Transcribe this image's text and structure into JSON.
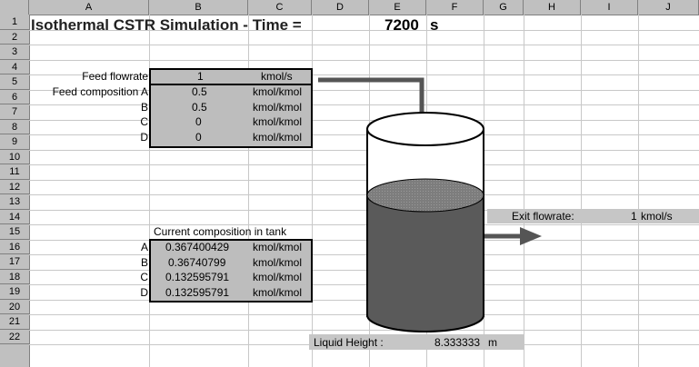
{
  "columns": [
    "A",
    "B",
    "C",
    "D",
    "E",
    "F",
    "G",
    "H",
    "I",
    "J"
  ],
  "rows": [
    "1",
    "2",
    "3",
    "4",
    "5",
    "6",
    "7",
    "8",
    "9",
    "10",
    "11",
    "12",
    "13",
    "14",
    "15",
    "16",
    "17",
    "18",
    "19",
    "20",
    "21",
    "22"
  ],
  "title": "Isothermal CSTR Simulation - Time =",
  "time_value": "7200",
  "time_unit": "s",
  "feed": {
    "flowrate_label": "Feed flowrate",
    "flowrate_value": "1",
    "flowrate_unit": "kmol/s",
    "composition_label": "Feed composition A",
    "components": [
      {
        "label": "",
        "value": "0.5",
        "unit": "kmol/kmol"
      },
      {
        "label": "B",
        "value": "0.5",
        "unit": "kmol/kmol"
      },
      {
        "label": "C",
        "value": "0",
        "unit": "kmol/kmol"
      },
      {
        "label": "D",
        "value": "0",
        "unit": "kmol/kmol"
      }
    ]
  },
  "tank": {
    "heading": "Current composition in tank",
    "components": [
      {
        "label": "A",
        "value": "0.367400429",
        "unit": "kmol/kmol"
      },
      {
        "label": "B",
        "value": "0.36740799",
        "unit": "kmol/kmol"
      },
      {
        "label": "C",
        "value": "0.132595791",
        "unit": "kmol/kmol"
      },
      {
        "label": "D",
        "value": "0.132595791",
        "unit": "kmol/kmol"
      }
    ]
  },
  "exit": {
    "label": "Exit flowrate:",
    "value": "1",
    "unit": "kmol/s"
  },
  "liquid": {
    "label": "Liquid Height :",
    "value": "8.333333",
    "unit": "m"
  },
  "colors": {
    "liquid": "#5a5a5a",
    "liquid_surface": "#7d7d7d",
    "box": "#bdbdbd",
    "arrow": "#555555"
  }
}
